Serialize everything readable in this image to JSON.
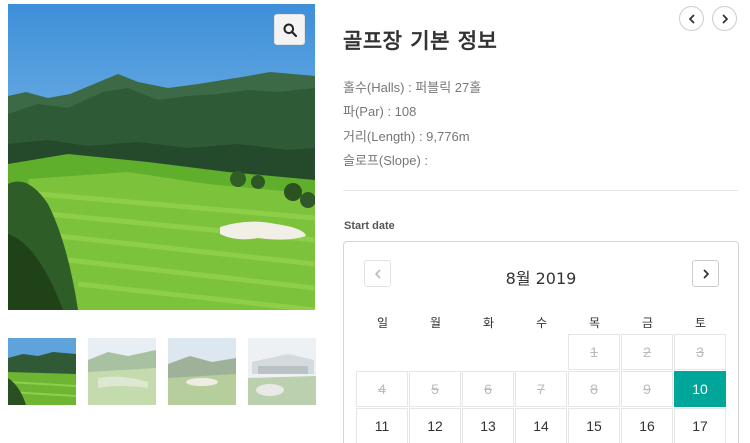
{
  "gallery": {
    "zoom_icon": "search-icon",
    "thumbnails": [
      "thumbnail-course",
      "thumbnail-fairway",
      "thumbnail-green",
      "thumbnail-clubhouse"
    ]
  },
  "nav": {
    "prev_icon": "chevron-left-icon",
    "next_icon": "chevron-right-icon"
  },
  "info": {
    "title": "골프장 기본 정보",
    "halls": "홀수(Halls) : 퍼블릭 27홀",
    "par": "파(Par) : 108",
    "length": "거리(Length) : 9,776m",
    "slope": "슬로프(Slope) :"
  },
  "calendar": {
    "label": "Start date",
    "month": "8월 2019",
    "weekdays": [
      "일",
      "월",
      "화",
      "수",
      "목",
      "금",
      "토"
    ],
    "weeks": [
      [
        "",
        "",
        "",
        "",
        "1",
        "2",
        "3"
      ],
      [
        "4",
        "5",
        "6",
        "7",
        "8",
        "9",
        "10"
      ],
      [
        "11",
        "12",
        "13",
        "14",
        "15",
        "16",
        "17"
      ]
    ],
    "disabled": [
      "1",
      "2",
      "3",
      "4",
      "5",
      "6",
      "7",
      "8",
      "9"
    ],
    "selected": "10",
    "accent_color": "#00a699"
  }
}
